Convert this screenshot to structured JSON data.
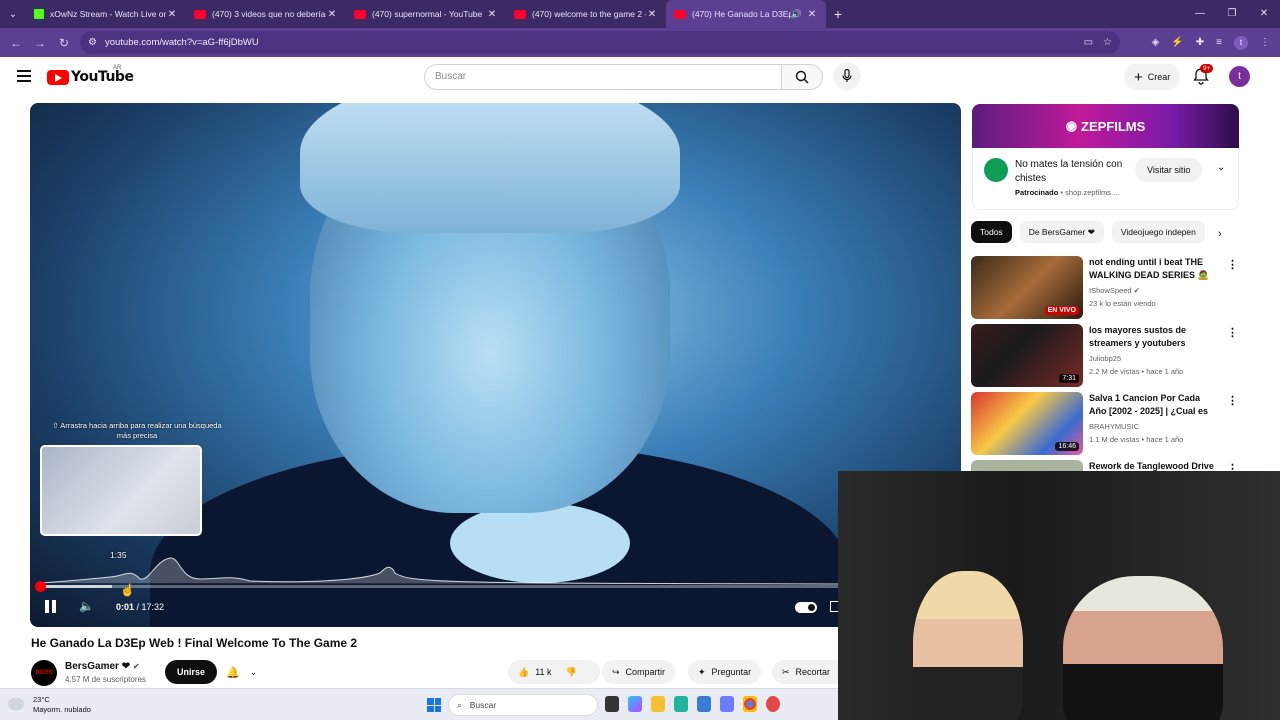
{
  "browser": {
    "tabs": [
      {
        "title": "xOwNz Stream - Watch Live on",
        "favicon": "kick-icon",
        "active": false
      },
      {
        "title": "(470) 3 videos que no deberías",
        "favicon": "youtube-icon",
        "active": false
      },
      {
        "title": "(470) supernormal - YouTube",
        "favicon": "youtube-icon",
        "active": false
      },
      {
        "title": "(470) welcome to the game 2 -",
        "favicon": "youtube-icon",
        "active": false
      },
      {
        "title": "(470) He Ganado La D3Ep W",
        "favicon": "youtube-icon",
        "active": true
      }
    ],
    "url": "youtube.com/watch?v=aG-ff6jDbWU",
    "profile_initial": "t"
  },
  "youtube": {
    "logo_text": "YouTube",
    "country_code": "AR",
    "search_placeholder": "Buscar",
    "create_label": "Crear",
    "notifications_badge": "9+",
    "avatar_initial": "t"
  },
  "player": {
    "hover_hint": "⇧ Arrastra hacia arriba para realizar una búsqueda más precisa",
    "preview_time": "1:35",
    "current_time": "0:01",
    "duration": "17:32",
    "played_fraction": 0.001,
    "hover_fraction": 0.09
  },
  "video": {
    "title": "He Ganado La D3Ep Web ! Final Welcome To The Game 2",
    "channel_name": "BersGamer ❤",
    "channel_avatar_text": "BERS",
    "subscribers": "4.57 M de suscriptores",
    "join_label": "Unirse",
    "likes": "11 k",
    "share_label": "Compartir",
    "ask_label": "Preguntar",
    "clip_label": "Recortar"
  },
  "ad": {
    "banner_text": "ZEPFILMS",
    "title": "No mates la tensión con chistes",
    "sponsored_label": "Patrocinado",
    "domain": "shop.zepfilms....",
    "cta_label": "Visitar sitio"
  },
  "chips": [
    "Todos",
    "De BersGamer ❤",
    "Videojuego indepen"
  ],
  "recommendations": [
    {
      "title": "not ending until i beat THE WALKING DEAD SERIES 🧟 💀...",
      "channel": "IShowSpeed",
      "meta": "23 k lo están viendo",
      "badge": "EN VIVO"
    },
    {
      "title": "los mayores sustos de streamers y youtubers (especi...",
      "channel": "Juliobp25",
      "meta": "2.2 M de vistas • hace 1 año",
      "badge": "7:31"
    },
    {
      "title": "Salva 1 Cancion Por Cada Año [2002 - 2025] | ¿Cual es tu ...",
      "channel": "BRAHYMUSIC",
      "meta": "1.1 M de vistas • hace 1 año",
      "badge": "16:46"
    },
    {
      "title": "Rework de Tanglewood Drive",
      "channel": "",
      "meta": "",
      "badge": ""
    }
  ],
  "taskbar": {
    "temperature": "23°C",
    "weather": "Mayorm. nublado",
    "search_label": "Buscar"
  }
}
